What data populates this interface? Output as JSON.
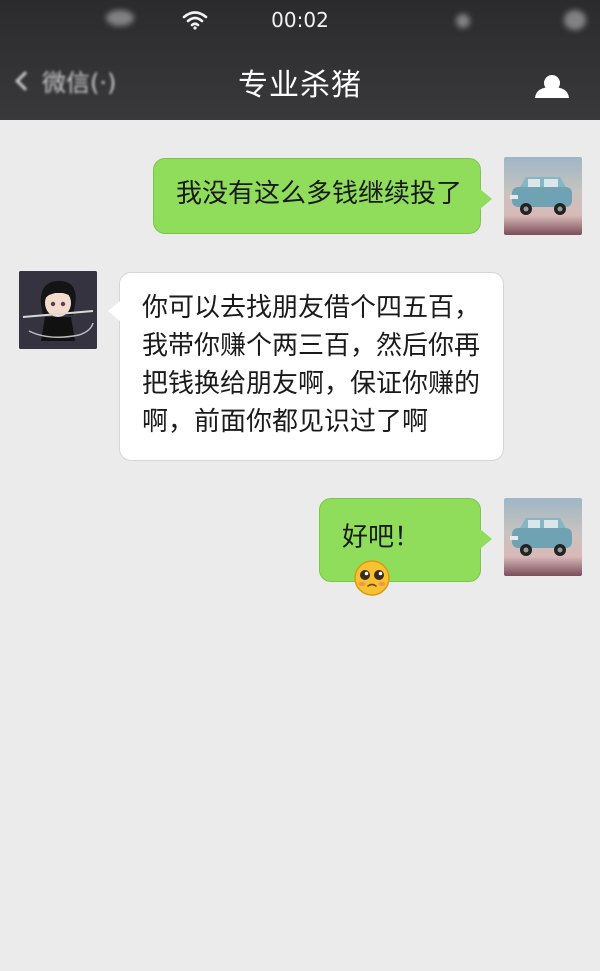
{
  "status_bar": {
    "time": "00:02"
  },
  "nav": {
    "back_label": "微信(·)",
    "title": "专业杀猪"
  },
  "messages": [
    {
      "side": "outgoing",
      "text": "我没有这么多钱继续投了"
    },
    {
      "side": "incoming",
      "lines": [
        "你可以去找朋友借个四五百，",
        "我带你赚个两三百，然后你再",
        "把钱换给朋友啊，保证你赚的",
        "啊，前面你都见识过了啊"
      ]
    },
    {
      "side": "outgoing",
      "text": "好吧！",
      "emoji": "pleading-face-icon"
    }
  ],
  "colors": {
    "topbar": "#2b2b2d",
    "chat_background": "#ebebeb",
    "outgoing_bubble": "#8fdd5b",
    "incoming_bubble": "#ffffff"
  }
}
